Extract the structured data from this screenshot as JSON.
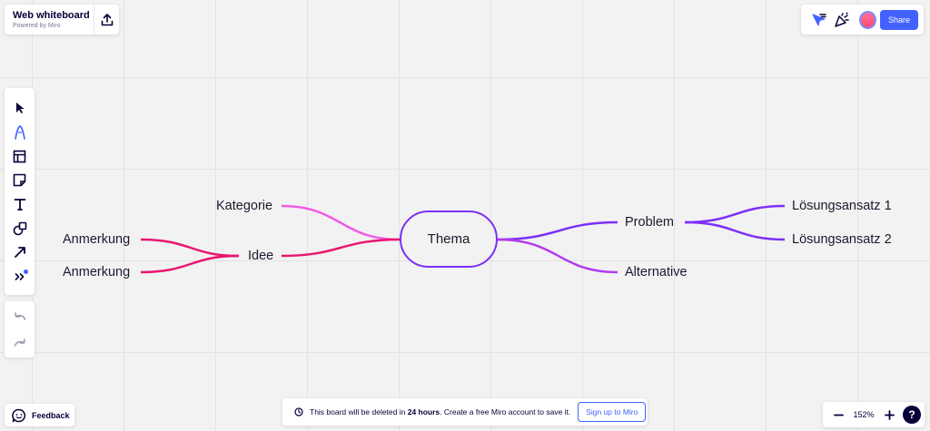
{
  "board": {
    "title": "Web whiteboard",
    "subtitle": "Powered by Miro"
  },
  "header": {
    "share_label": "Share"
  },
  "mindmap": {
    "central": "Thema",
    "nodes": {
      "kategorie": "Kategorie",
      "idee": "Idee",
      "anmerkung_1": "Anmerkung",
      "anmerkung_2": "Anmerkung",
      "problem": "Problem",
      "alternative": "Alternative",
      "loesung_1": "Lösungsansatz 1",
      "loesung_2": "Lösungsansatz 2"
    },
    "colors": {
      "pink": "#f25ce6",
      "magenta": "#e8166f",
      "purple": "#7b2ff7",
      "violet": "#b23cf0"
    }
  },
  "notice": {
    "text_before": "This board will be deleted in ",
    "text_bold": "24 hours",
    "text_after": ". Create a free Miro account to save it.",
    "signup_label": "Sign up to Miro"
  },
  "feedback": {
    "label": "Feedback"
  },
  "zoom": {
    "level": "152%"
  },
  "colors": {
    "accent": "#4262ff",
    "text": "#050038"
  },
  "icons": {
    "export": "upload-icon",
    "top_right": [
      "cursor-filter-icon",
      "celebrate-icon"
    ],
    "toolbar": [
      "select-icon",
      "pen-icon",
      "template-icon",
      "sticky-note-icon",
      "text-icon",
      "shapes-icon",
      "arrow-icon",
      "more-icon"
    ],
    "history": [
      "undo-icon",
      "redo-icon"
    ]
  }
}
